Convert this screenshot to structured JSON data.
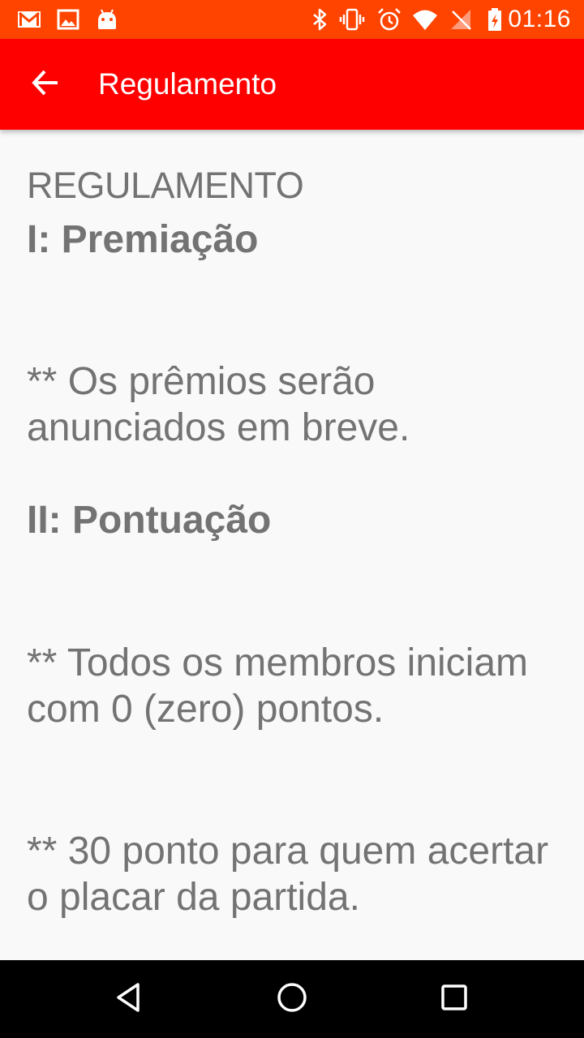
{
  "status_bar": {
    "time": "01:16",
    "background": "#ff4400",
    "left_icons": [
      "gmail-icon",
      "gallery-icon",
      "android-icon"
    ],
    "right_icons": [
      "bluetooth-icon",
      "vibrate-icon",
      "alarm-icon",
      "wifi-icon",
      "no-signal-icon",
      "battery-charging-icon"
    ]
  },
  "app_bar": {
    "title": "Regulamento",
    "background": "#ff0000",
    "back_icon": "arrow-back-icon"
  },
  "content": {
    "heading": "REGULAMENTO",
    "sections": [
      {
        "title": "I: Premiação",
        "paragraphs": [
          "** Os prêmios serão anunciados em breve."
        ]
      },
      {
        "title": "II: Pontuação",
        "paragraphs": [
          "** Todos os membros iniciam com 0 (zero) pontos.",
          "** 30 ponto para quem acertar o placar da partida."
        ]
      }
    ],
    "text_color": "#737373"
  },
  "nav_bar": {
    "buttons": [
      "back-triangle-icon",
      "home-circle-icon",
      "recents-square-icon"
    ]
  }
}
